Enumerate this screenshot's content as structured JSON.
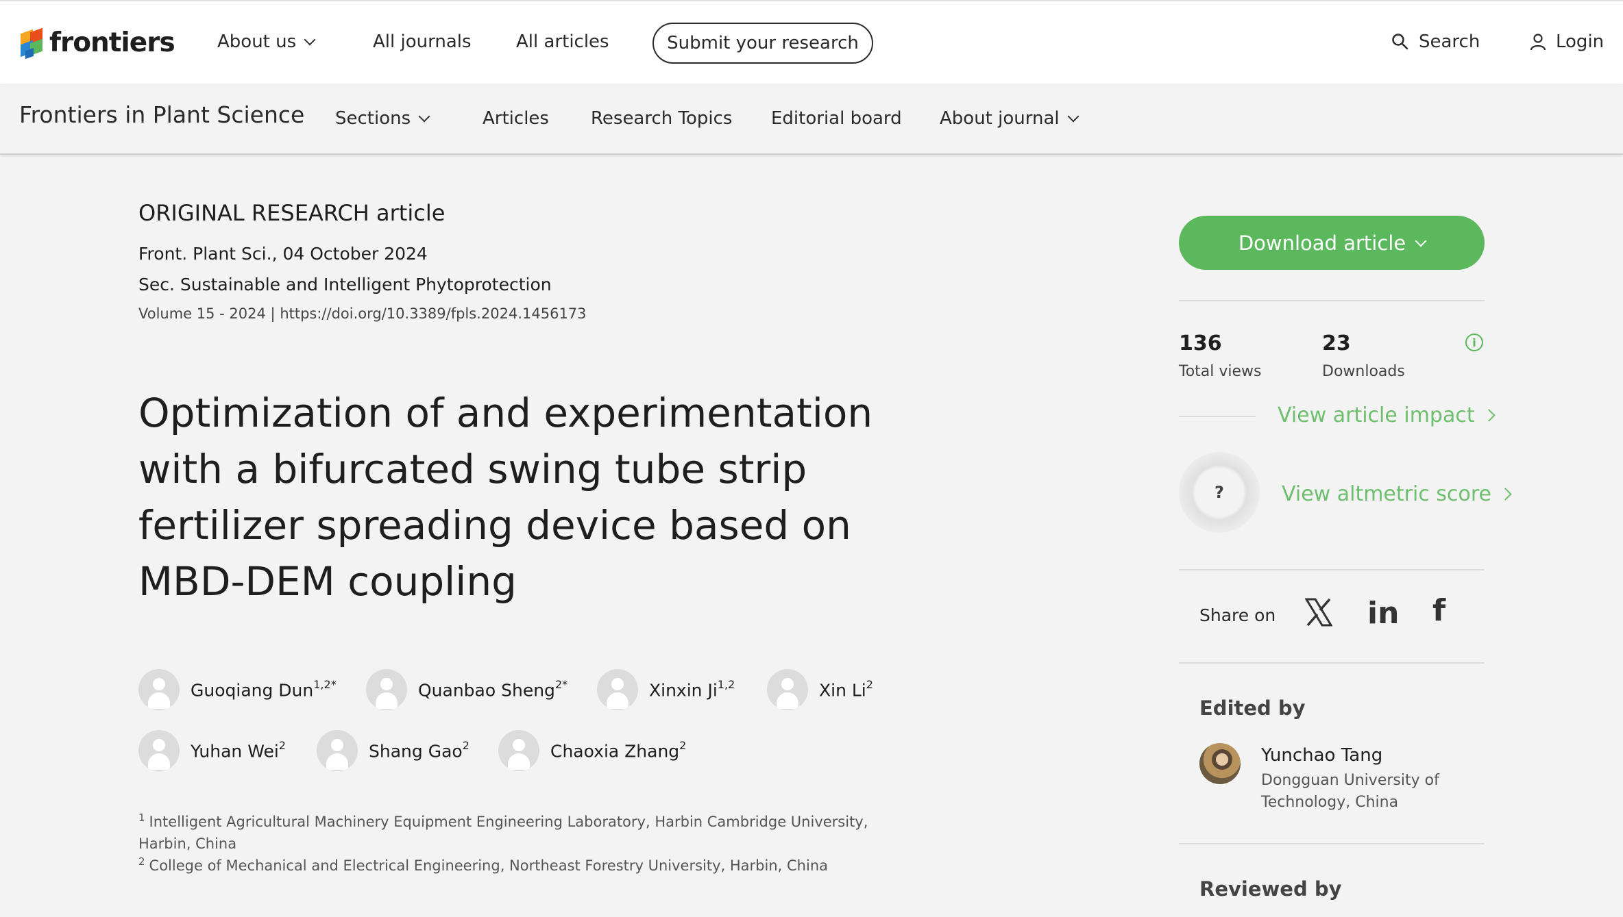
{
  "topbar": {
    "logo_text": "frontiers",
    "nav": [
      {
        "label": "About us"
      },
      {
        "label": "All journals"
      },
      {
        "label": "All articles"
      }
    ],
    "submit_label": "Submit your research",
    "search_label": "Search",
    "login_label": "Login"
  },
  "journal_bar": {
    "title": "Frontiers in Plant Science",
    "nav": [
      {
        "label": "Sections"
      },
      {
        "label": "Articles"
      },
      {
        "label": "Research Topics"
      },
      {
        "label": "Editorial board"
      },
      {
        "label": "About journal"
      }
    ]
  },
  "article": {
    "type_strong": "ORIGINAL RESEARCH",
    "type_rest": " article",
    "journal_date": "Front. Plant Sci., 04 October 2024",
    "section": "Sec. Sustainable and Intelligent Phytoprotection",
    "volume": "Volume 15 - 2024 | ",
    "doi": "https://doi.org/10.3389/fpls.2024.1456173",
    "title": "Optimization of and experimentation with a bifurcated swing tube strip fertilizer spreading device based on MBD-DEM coupling",
    "authors": [
      {
        "name": "Guoqiang Dun",
        "sup": "1,2*"
      },
      {
        "name": "Quanbao Sheng",
        "sup": "2*"
      },
      {
        "name": "Xinxin Ji",
        "sup": "1,2"
      },
      {
        "name": "Xin Li",
        "sup": "2"
      },
      {
        "name": "Yuhan Wei",
        "sup": "2"
      },
      {
        "name": "Shang Gao",
        "sup": "2"
      },
      {
        "name": "Chaoxia Zhang",
        "sup": "2"
      }
    ],
    "affiliations": [
      {
        "num": "1",
        "text": "Intelligent Agricultural Machinery Equipment Engineering Laboratory, Harbin Cambridge University, Harbin, China"
      },
      {
        "num": "2",
        "text": "College of Mechanical and Electrical Engineering, Northeast Forestry University, Harbin, China"
      }
    ]
  },
  "sidebar": {
    "download_label": "Download article",
    "views_num": "136",
    "views_label": "Total views",
    "downloads_num": "23",
    "downloads_label": "Downloads",
    "impact_label": "View article impact",
    "altmetric_badge": "?",
    "altmetric_label": "View altmetric score",
    "share_label": "Share on",
    "social": {
      "x": "𝕏",
      "linkedin": "in",
      "facebook": "f"
    },
    "edited_by": "Edited by",
    "editor": {
      "name": "Yunchao Tang",
      "affiliation": "Dongguan University of Technology, China"
    },
    "reviewed_by": "Reviewed by"
  },
  "colors": {
    "accent_green": "#5cb85c",
    "link_green": "#6dbf6d"
  },
  "icons": [
    "frontiers-logo-icon",
    "chevron-down-icon",
    "search-icon",
    "user-icon",
    "info-icon",
    "chevron-right-icon",
    "x-icon",
    "linkedin-icon",
    "facebook-icon"
  ]
}
